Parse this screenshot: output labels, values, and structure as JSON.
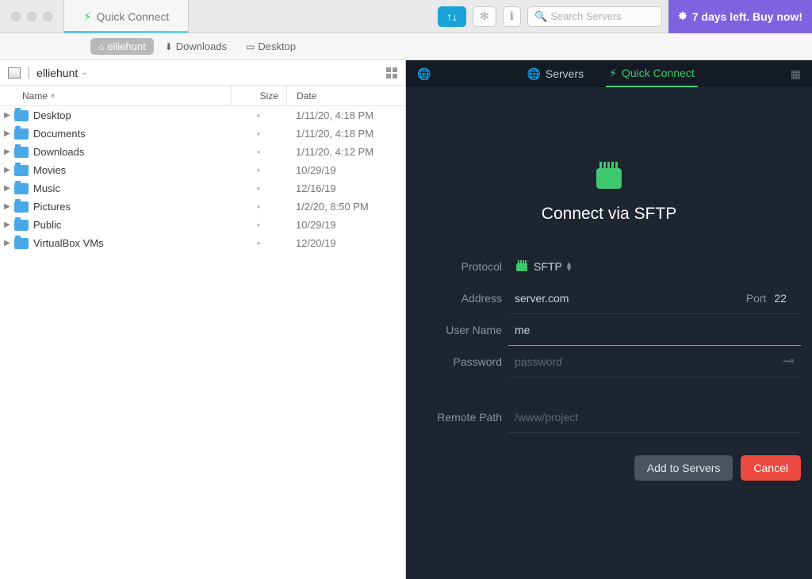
{
  "titlebar": {
    "tab_label": "Quick Connect",
    "search_placeholder": "Search Servers",
    "buy_now": "7 days left. Buy now!"
  },
  "pathbar": {
    "crumbs": [
      {
        "label": "elliehunt",
        "icon": "home"
      },
      {
        "label": "Downloads",
        "icon": "download"
      },
      {
        "label": "Desktop",
        "icon": "desktop"
      }
    ]
  },
  "local": {
    "location": "elliehunt",
    "columns": {
      "name": "Name",
      "size": "Size",
      "date": "Date"
    },
    "rows": [
      {
        "name": "Desktop",
        "date": "1/11/20, 4:18 PM"
      },
      {
        "name": "Documents",
        "date": "1/11/20, 4:18 PM"
      },
      {
        "name": "Downloads",
        "date": "1/11/20, 4:12 PM"
      },
      {
        "name": "Movies",
        "date": "10/29/19"
      },
      {
        "name": "Music",
        "date": "12/16/19"
      },
      {
        "name": "Pictures",
        "date": "1/2/20, 8:50 PM"
      },
      {
        "name": "Public",
        "date": "10/29/19"
      },
      {
        "name": "VirtualBox VMs",
        "date": "12/20/19"
      }
    ]
  },
  "remote": {
    "tabs": {
      "servers": "Servers",
      "quick_connect": "Quick Connect"
    },
    "title": "Connect via SFTP",
    "labels": {
      "protocol": "Protocol",
      "address": "Address",
      "port": "Port",
      "username": "User Name",
      "password": "Password",
      "remote_path": "Remote Path"
    },
    "values": {
      "protocol": "SFTP",
      "address": "server.com",
      "port": "22",
      "username": "me",
      "password_placeholder": "password",
      "remote_path_placeholder": "/www/project"
    },
    "actions": {
      "add": "Add to Servers",
      "cancel": "Cancel"
    }
  }
}
